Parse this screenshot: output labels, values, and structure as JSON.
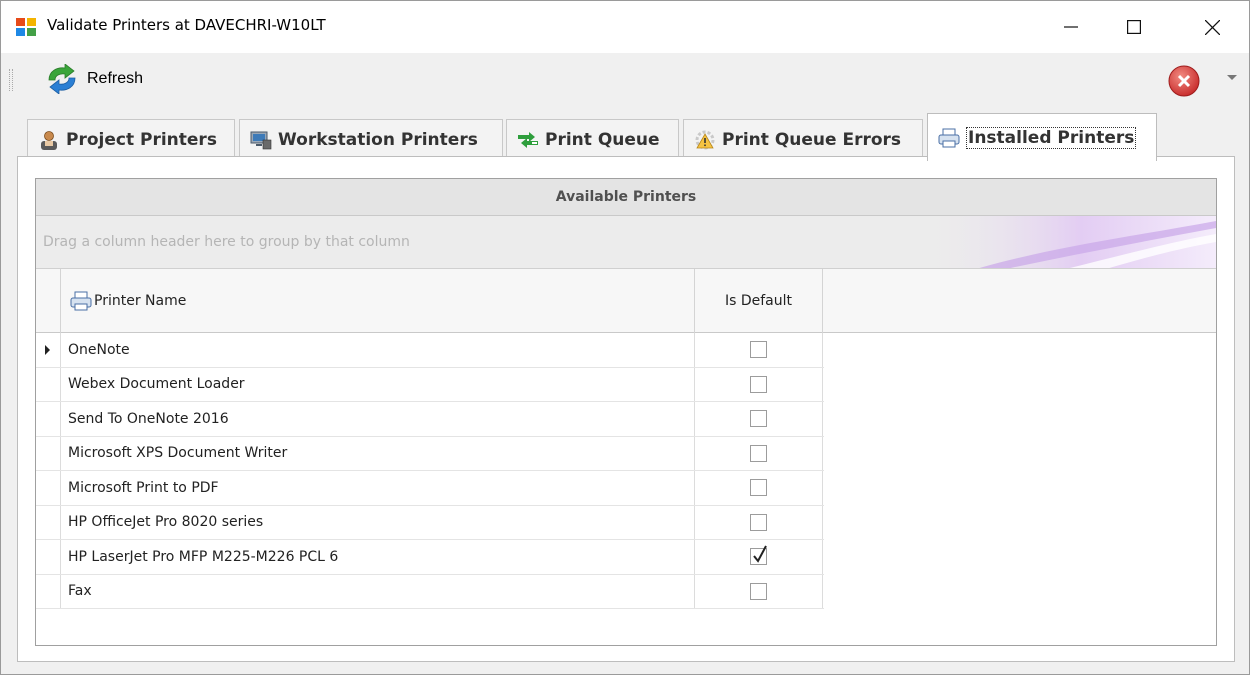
{
  "window": {
    "title": "Validate Printers at DAVECHRI-W10LT",
    "controls": {
      "minimize": "—",
      "maximize": "☐",
      "close": "✕"
    }
  },
  "toolbar": {
    "refresh_label": "Refresh",
    "refresh_icon": "refresh-icon",
    "error_icon": "error-close-icon"
  },
  "tabs": [
    {
      "label": "Project Printers",
      "icon": "user-icon",
      "active": false
    },
    {
      "label": "Workstation Printers",
      "icon": "workstation-icon",
      "active": false
    },
    {
      "label": "Print Queue",
      "icon": "queue-icon",
      "active": false
    },
    {
      "label": "Print Queue Errors",
      "icon": "warning-icon",
      "active": false
    },
    {
      "label": "Installed Printers",
      "icon": "printer-icon",
      "active": true
    }
  ],
  "grid": {
    "caption": "Available Printers",
    "group_hint": "Drag a column header here to group by that column",
    "columns": {
      "name": "Printer Name",
      "is_default": "Is Default"
    },
    "rows": [
      {
        "name": "OneNote",
        "is_default": false,
        "current": true
      },
      {
        "name": "Webex Document Loader",
        "is_default": false
      },
      {
        "name": "Send To OneNote 2016",
        "is_default": false
      },
      {
        "name": "Microsoft XPS Document Writer",
        "is_default": false
      },
      {
        "name": "Microsoft Print to PDF",
        "is_default": false
      },
      {
        "name": "HP OfficeJet Pro 8020 series",
        "is_default": false
      },
      {
        "name": "HP LaserJet Pro MFP M225-M226 PCL 6",
        "is_default": true
      },
      {
        "name": "Fax",
        "is_default": false
      }
    ]
  },
  "colors": {
    "accent_swoosh": "#c9a6e8",
    "error_red": "#d9352a",
    "refresh_green": "#3aa53a",
    "refresh_blue": "#2b7fd4"
  }
}
